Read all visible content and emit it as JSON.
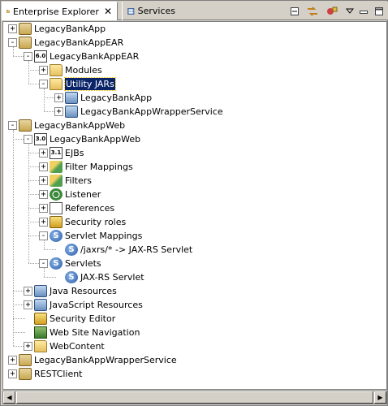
{
  "tabs": [
    {
      "label": "Enterprise Explorer",
      "close": "✕",
      "active": true,
      "icon": "enterprise-explorer-icon"
    },
    {
      "label": "Services",
      "active": false,
      "icon": "services-icon"
    }
  ],
  "toolbar": {
    "minimize": "minimize-icon",
    "link": "link-with-editor-icon",
    "collapse": "collapse-all-icon",
    "menu": "view-menu-icon"
  },
  "tree": [
    {
      "label": "LegacyBankApp",
      "level": 0,
      "expander": "+",
      "icon": "project-icon"
    },
    {
      "label": "LegacyBankAppEAR",
      "level": 0,
      "expander": "-",
      "icon": "ear-project-icon"
    },
    {
      "label": "LegacyBankAppEAR",
      "level": 1,
      "expander": "-",
      "icon": "deployment-descriptor-icon",
      "badge": "6.0"
    },
    {
      "label": "Modules",
      "level": 2,
      "expander": "+",
      "icon": "folder-icon"
    },
    {
      "label": "Utility JARs",
      "level": 2,
      "expander": "-",
      "icon": "folder-icon",
      "selected": true
    },
    {
      "label": "LegacyBankApp",
      "level": 3,
      "expander": "+",
      "icon": "utility-jar-icon"
    },
    {
      "label": "LegacyBankAppWrapperService",
      "level": 3,
      "expander": "+",
      "icon": "utility-jar-icon"
    },
    {
      "label": "LegacyBankAppWeb",
      "level": 0,
      "expander": "-",
      "icon": "web-project-icon"
    },
    {
      "label": "LegacyBankAppWeb",
      "level": 1,
      "expander": "-",
      "icon": "deployment-descriptor-icon",
      "badge": "3.0"
    },
    {
      "label": "EJBs",
      "level": 2,
      "expander": "+",
      "icon": "ejbs-icon",
      "badge": "3.1"
    },
    {
      "label": "Filter Mappings",
      "level": 2,
      "expander": "+",
      "icon": "filter-mapping-icon"
    },
    {
      "label": "Filters",
      "level": 2,
      "expander": "+",
      "icon": "filter-icon"
    },
    {
      "label": "Listener",
      "level": 2,
      "expander": "+",
      "icon": "listener-icon"
    },
    {
      "label": "References",
      "level": 2,
      "expander": "+",
      "icon": "references-icon"
    },
    {
      "label": "Security roles",
      "level": 2,
      "expander": "+",
      "icon": "security-roles-icon"
    },
    {
      "label": "Servlet Mappings",
      "level": 2,
      "expander": "-",
      "icon": "servlet-mapping-icon"
    },
    {
      "label": "/jaxrs/* -> JAX-RS Servlet",
      "level": 3,
      "expander": "",
      "icon": "servlet-mapping-icon"
    },
    {
      "label": "Servlets",
      "level": 2,
      "expander": "-",
      "icon": "servlet-icon"
    },
    {
      "label": "JAX-RS Servlet",
      "level": 3,
      "expander": "",
      "icon": "servlet-icon"
    },
    {
      "label": "Java Resources",
      "level": 1,
      "expander": "+",
      "icon": "java-resources-icon"
    },
    {
      "label": "JavaScript Resources",
      "level": 1,
      "expander": "+",
      "icon": "javascript-resources-icon"
    },
    {
      "label": "Security Editor",
      "level": 1,
      "expander": "",
      "icon": "security-editor-icon"
    },
    {
      "label": "Web Site Navigation",
      "level": 1,
      "expander": "",
      "icon": "web-site-navigation-icon"
    },
    {
      "label": "WebContent",
      "level": 1,
      "expander": "+",
      "icon": "folder-icon"
    },
    {
      "label": "LegacyBankAppWrapperService",
      "level": 0,
      "expander": "+",
      "icon": "project-icon"
    },
    {
      "label": "RESTClient",
      "level": 0,
      "expander": "+",
      "icon": "project-icon"
    }
  ],
  "scrollbar": {
    "left_arrow": "◀",
    "right_arrow": "▶"
  }
}
